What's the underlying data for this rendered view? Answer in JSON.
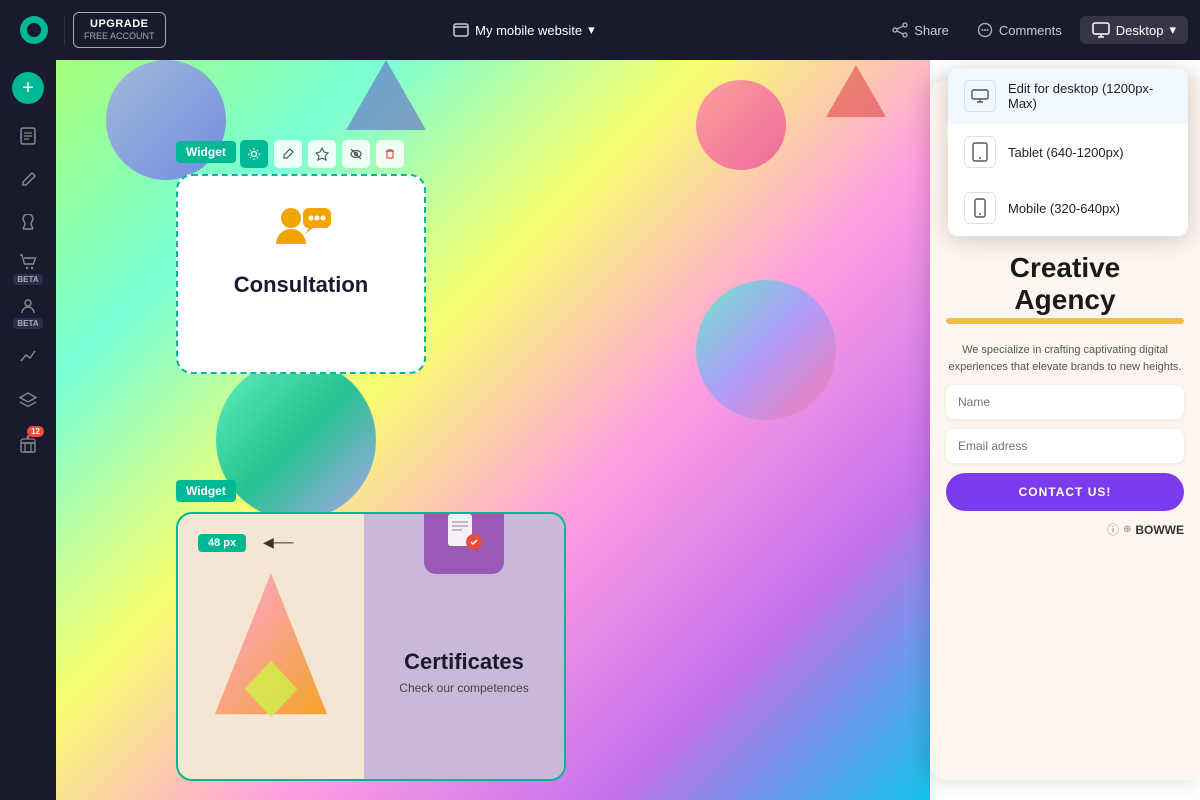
{
  "topbar": {
    "logo_alt": "BOWWE logo",
    "upgrade_top": "UPGRADE",
    "upgrade_bot": "FREE ACCOUNT",
    "website_label": "My mobile website",
    "share_label": "Share",
    "comments_label": "Comments",
    "desktop_label": "Desktop",
    "chevron": "▾"
  },
  "sidebar": {
    "add_label": "+",
    "items": [
      {
        "name": "pages",
        "icon": "pages"
      },
      {
        "name": "edit",
        "icon": "edit"
      },
      {
        "name": "paint",
        "icon": "paint"
      },
      {
        "name": "cart",
        "icon": "cart",
        "badge": "BETA"
      },
      {
        "name": "crm",
        "icon": "crm",
        "badge": "BETA"
      },
      {
        "name": "analytics",
        "icon": "analytics"
      },
      {
        "name": "layers",
        "icon": "layers"
      },
      {
        "name": "gifts",
        "icon": "gifts",
        "count": "12"
      }
    ]
  },
  "widget1": {
    "label": "Widget",
    "card_title": "Consultation",
    "icon_alt": "consultation icon"
  },
  "widget2": {
    "label": "Widget",
    "px_label": "48 px",
    "cert_title": "Certificates",
    "cert_subtitle": "Check our competences"
  },
  "preview": {
    "star": "✳",
    "title": "Creative\nAgency",
    "desc": "We specialize in crafting captivating digital experiences that elevate brands to new heights.",
    "name_placeholder": "Name",
    "email_placeholder": "Email adress",
    "cta_label": "CONTACT US!",
    "footer_label": "BOWWE"
  },
  "dropdown": {
    "items": [
      {
        "id": "desktop",
        "label": "Edit for desktop (1200px-Max)",
        "icon": "desktop",
        "active": true
      },
      {
        "id": "tablet",
        "label": "Tablet (640-1200px)",
        "icon": "tablet",
        "active": false
      },
      {
        "id": "mobile",
        "label": "Mobile (320-640px)",
        "icon": "mobile",
        "active": false
      }
    ]
  }
}
